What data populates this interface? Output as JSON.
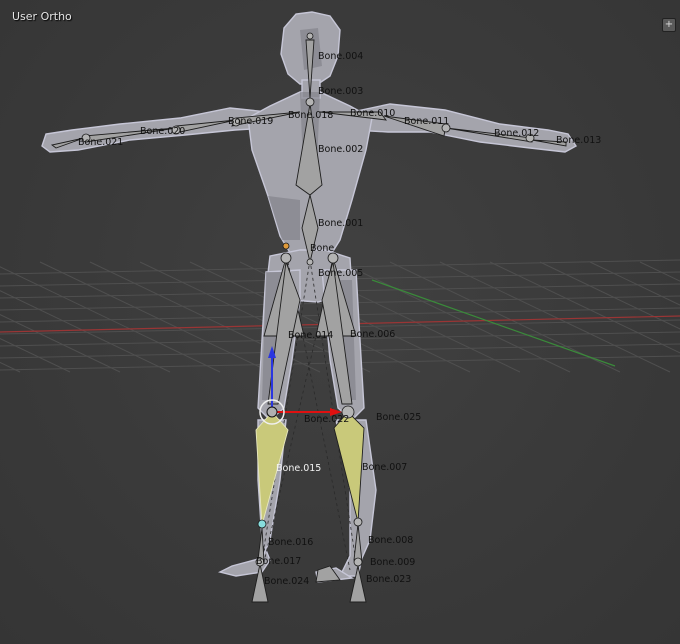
{
  "viewport": {
    "title": "User Ortho",
    "add_button": "+"
  },
  "colors": {
    "background": "#393939",
    "grid": "#4e4e4e",
    "x_axis": "#9a3535",
    "y_axis": "#3a8a3a",
    "mesh": "#a4a4ac",
    "mesh_dark": "#7c7c84",
    "mesh_edge": "#c6c6d6",
    "bone": "#9c9c9c",
    "bone_selected": "#c9c97a",
    "gizmo_x": "#e01010",
    "gizmo_z": "#2a36e0"
  },
  "bones": [
    {
      "id": "bone_004",
      "label": "Bone.004"
    },
    {
      "id": "bone_003",
      "label": "Bone.003"
    },
    {
      "id": "bone_020",
      "label": "Bone.020"
    },
    {
      "id": "bone_019",
      "label": "Bone.019"
    },
    {
      "id": "bone_018",
      "label": "Bone.018"
    },
    {
      "id": "bone_010",
      "label": "Bone.010"
    },
    {
      "id": "bone_011",
      "label": "Bone.011"
    },
    {
      "id": "bone_012",
      "label": "Bone.012"
    },
    {
      "id": "bone_013",
      "label": "Bone.013"
    },
    {
      "id": "bone_021",
      "label": "Bone.021"
    },
    {
      "id": "bone_002",
      "label": "Bone.002"
    },
    {
      "id": "bone_001",
      "label": "Bone.001"
    },
    {
      "id": "bone",
      "label": "Bone"
    },
    {
      "id": "bone_005",
      "label": "Bone.005"
    },
    {
      "id": "bone_014",
      "label": "Bone.014"
    },
    {
      "id": "bone_006",
      "label": "Bone.006"
    },
    {
      "id": "bone_022",
      "label": "Bone.022"
    },
    {
      "id": "bone_025",
      "label": "Bone.025"
    },
    {
      "id": "bone_015",
      "label": "Bone.015",
      "selected": true
    },
    {
      "id": "bone_007",
      "label": "Bone.007"
    },
    {
      "id": "bone_016",
      "label": "Bone.016"
    },
    {
      "id": "bone_008",
      "label": "Bone.008"
    },
    {
      "id": "bone_017",
      "label": "Bone.017"
    },
    {
      "id": "bone_009",
      "label": "Bone.009"
    },
    {
      "id": "bone_024",
      "label": "Bone.024"
    },
    {
      "id": "bone_023",
      "label": "Bone.023"
    }
  ]
}
